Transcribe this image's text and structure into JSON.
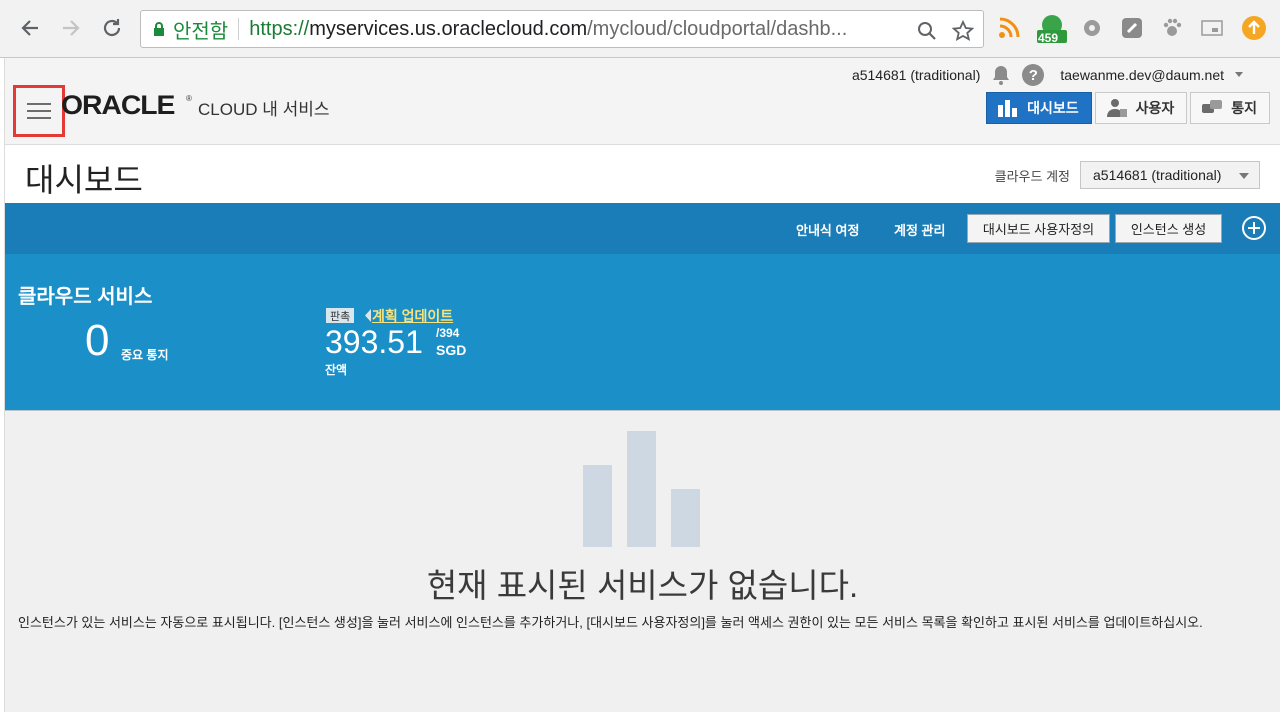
{
  "browser": {
    "secure_label": "안전함",
    "url_scheme": "https://",
    "url_host": "myservices.us.oraclecloud.com",
    "url_path": "/mycloud/cloudportal/dashb...",
    "ext_badge": "459"
  },
  "header": {
    "logo": "ORACLE",
    "logo_reg": "®",
    "cloud_title": "CLOUD 내 서비스",
    "account_name": "a514681 (traditional)",
    "help_glyph": "?",
    "user_email": "taewanme.dev@daum.net",
    "tabs": [
      {
        "label": "대시보드",
        "icon": "bar-chart-icon",
        "active": true
      },
      {
        "label": "사용자",
        "icon": "users-icon",
        "active": false
      },
      {
        "label": "통지",
        "icon": "notifications-icon",
        "active": false
      }
    ]
  },
  "title_row": {
    "page_title": "대시보드",
    "account_label": "클라우드 계정",
    "account_selected": "a514681 (traditional)"
  },
  "toolbar": {
    "guided_tour": "안내식 여정",
    "manage_account": "계정 관리",
    "customize_dashboard": "대시보드 사용자정의",
    "create_instance": "인스턴스 생성"
  },
  "summary": {
    "title": "클라우드 서비스",
    "important_count": "0",
    "important_label": "중요 통지",
    "trial_tag": "판촉",
    "plan_update_link": "계획 업데이트",
    "balance": "393.51",
    "balance_max": "/394",
    "currency": "SGD",
    "balance_label": "잔액"
  },
  "empty_state": {
    "title": "현재 표시된 서비스가 없습니다.",
    "description": "인스턴스가 있는 서비스는 자동으로 표시됩니다. [인스턴스 생성]을 눌러 서비스에 인스턴스를 추가하거나, [대시보드 사용자정의]를 눌러 액세스 권한이 있는 모든 서비스 목록을 확인하고 표시된 서비스를 업데이트하십시오."
  },
  "colors": {
    "toolbar_blue": "#1b7db7",
    "summary_blue": "#1a8fc8",
    "active_tab": "#1f72c4",
    "highlight_red": "#e53935",
    "plan_link_yellow": "#f7e27b"
  }
}
